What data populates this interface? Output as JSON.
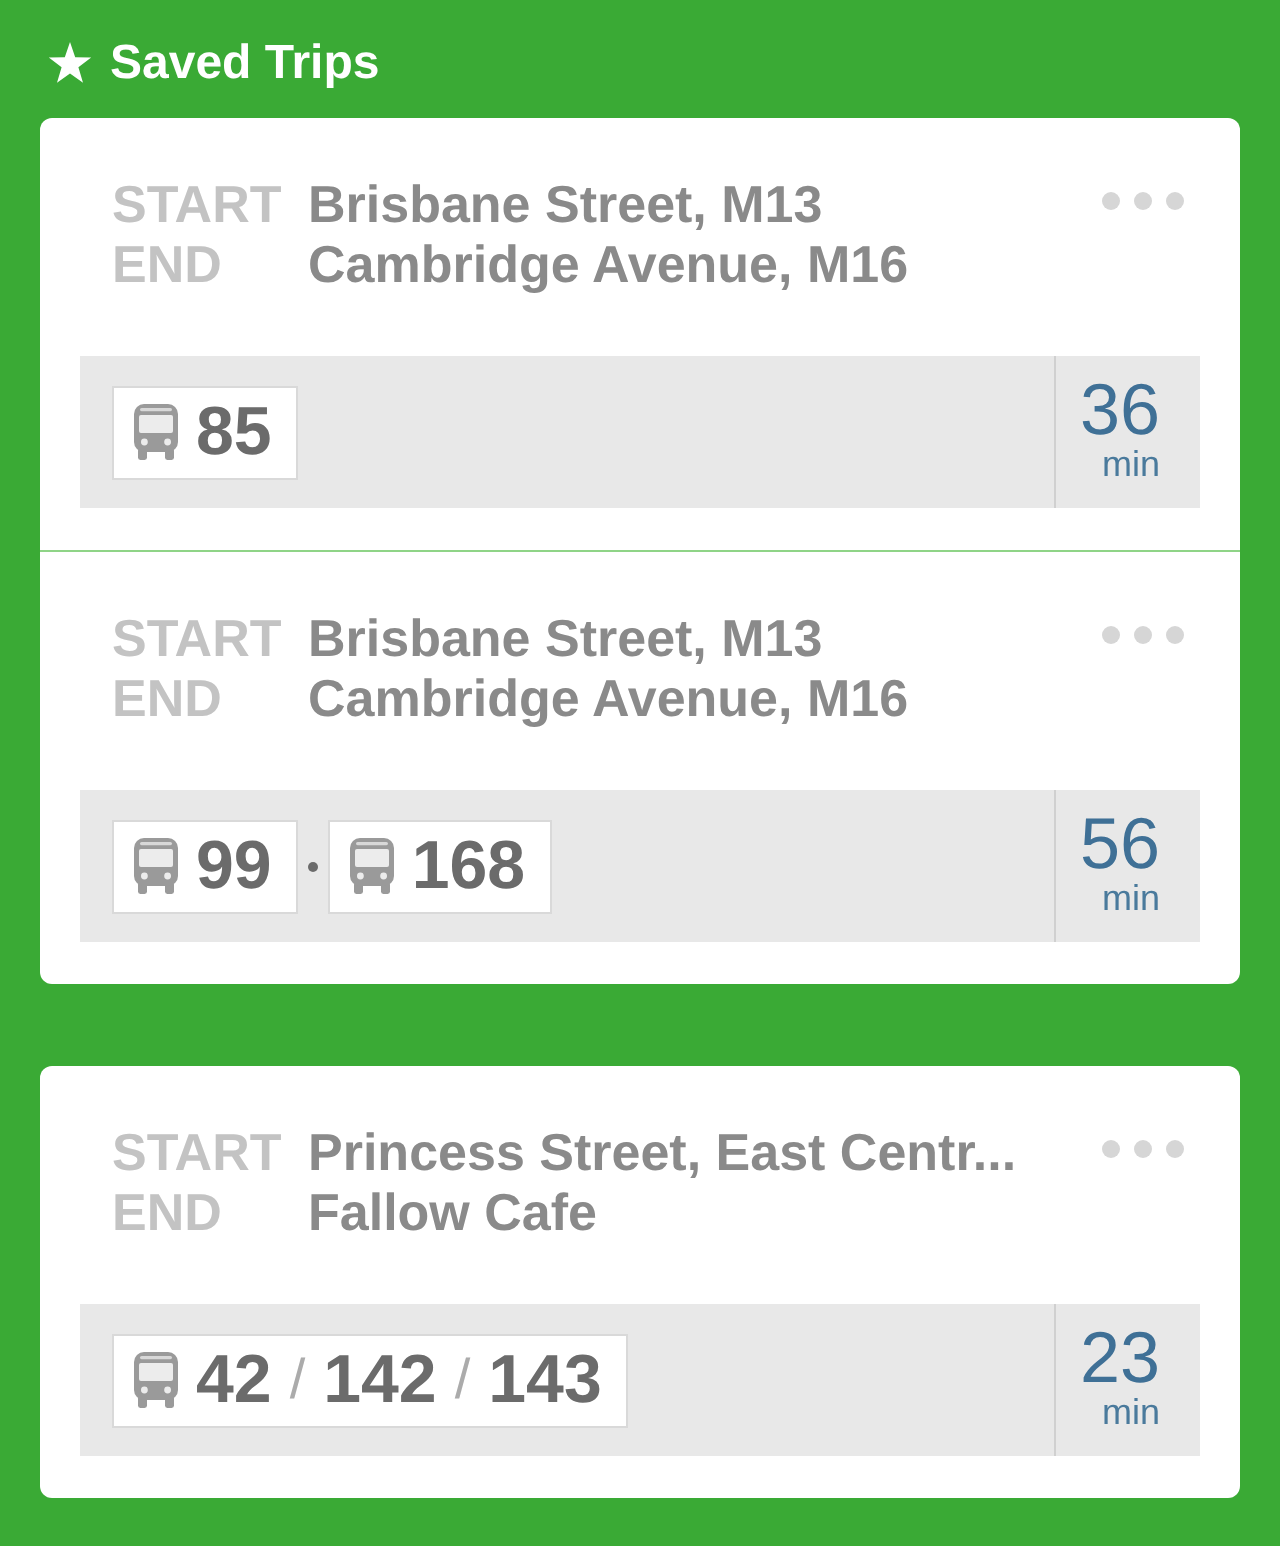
{
  "header": {
    "title": "Saved Trips"
  },
  "cards": [
    {
      "trips": [
        {
          "start_label": "START",
          "start": "Brisbane Street, M13",
          "end_label": "END",
          "end": "Cambridge Avenue, M16",
          "legs": [
            {
              "kind": "bus",
              "routes": [
                "85"
              ]
            }
          ],
          "duration": "36",
          "unit": "min"
        },
        {
          "start_label": "START",
          "start": "Brisbane Street, M13",
          "end_label": "END",
          "end": "Cambridge Avenue, M16",
          "legs": [
            {
              "kind": "bus",
              "routes": [
                "99"
              ]
            },
            {
              "kind": "bus",
              "routes": [
                "168"
              ]
            }
          ],
          "duration": "56",
          "unit": "min"
        }
      ]
    },
    {
      "trips": [
        {
          "start_label": "START",
          "start": "Princess Street, East Centr...",
          "end_label": "END",
          "end": "Fallow Cafe",
          "legs": [
            {
              "kind": "bus",
              "routes": [
                "42",
                "142",
                "143"
              ],
              "divider": "/"
            }
          ],
          "duration": "23",
          "unit": "min"
        }
      ]
    }
  ]
}
